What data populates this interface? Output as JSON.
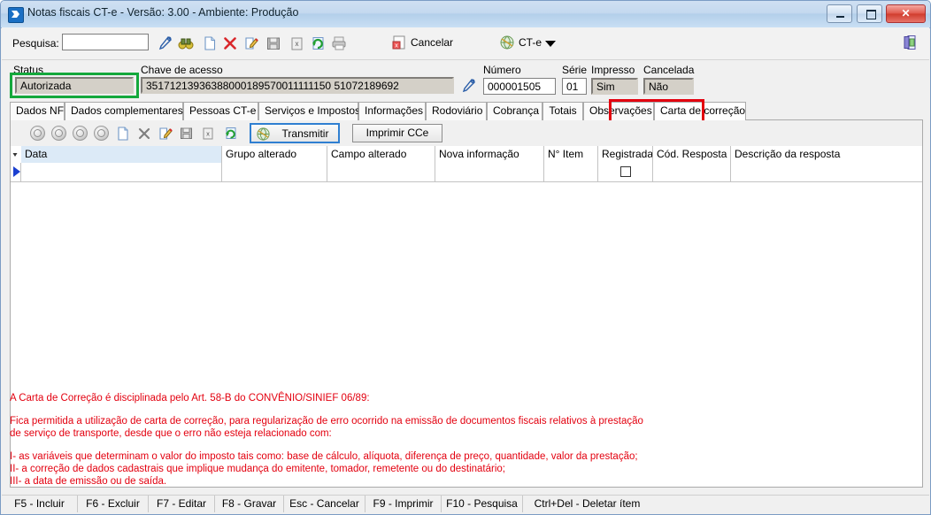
{
  "window": {
    "title": "Notas fiscais CT-e - Versão: 3.00 - Ambiente: Produção",
    "icon": "app-icon",
    "minimize_label": "",
    "maximize_label": "",
    "close_label": "✕"
  },
  "toolbar": {
    "search_label": "Pesquisa:",
    "search_value": "",
    "search_placeholder": "",
    "icons": [
      {
        "name": "filter-key-icon"
      },
      {
        "name": "binoculars-icon"
      },
      {
        "name": "new-document-icon"
      },
      {
        "name": "delete-x-icon"
      },
      {
        "name": "edit-pencil-icon"
      },
      {
        "name": "save-floppy-icon"
      },
      {
        "name": "cancel-document-icon"
      },
      {
        "name": "refresh-icon"
      },
      {
        "name": "print-icon"
      }
    ],
    "cancel_label": "Cancelar",
    "cte_label": "CT-e",
    "exit_icon": "exit-door-icon"
  },
  "header": {
    "status_label": "Status",
    "status_value": "Autorizada",
    "status_highlight_color": "#14a83c",
    "chave_label": "Chave de acesso",
    "chave_value": "35171213936388000189570011111150 51072189692",
    "chave_icon": "key-icon",
    "numero_label": "Número",
    "numero_value": "000001505",
    "serie_label": "Série",
    "serie_value": "01",
    "impresso_label": "Impresso",
    "impresso_value": "Sim",
    "cancelada_label": "Cancelada",
    "cancelada_value": "Não"
  },
  "tabs": [
    {
      "label": "Dados NF",
      "active": false
    },
    {
      "label": "Dados complementares",
      "active": false
    },
    {
      "label": "Pessoas CT-e",
      "active": false
    },
    {
      "label": "Serviços e Impostos",
      "active": false
    },
    {
      "label": "Informações",
      "active": false
    },
    {
      "label": "Rodoviário",
      "active": false
    },
    {
      "label": "Cobrança",
      "active": false
    },
    {
      "label": "Totais",
      "active": false
    },
    {
      "label": "Observações",
      "active": false
    },
    {
      "label": "Carta de correção",
      "active": true
    }
  ],
  "tab_highlight_color": "#e3000f",
  "inner_toolbar": {
    "nav_icons": [
      {
        "name": "nav-first-icon"
      },
      {
        "name": "nav-prev-icon"
      },
      {
        "name": "nav-next-icon"
      },
      {
        "name": "nav-last-icon"
      }
    ],
    "action_icons": [
      {
        "name": "new-record-icon"
      },
      {
        "name": "delete-record-icon"
      },
      {
        "name": "edit-record-icon"
      },
      {
        "name": "save-record-icon"
      },
      {
        "name": "cancel-record-icon"
      },
      {
        "name": "refresh-record-icon"
      }
    ],
    "transmitir_label": "Transmitir",
    "transmitir_icon": "cte-globe-icon",
    "imprimir_label": "Imprimir CCe"
  },
  "grid": {
    "columns": [
      {
        "label": "Data",
        "selected": true
      },
      {
        "label": "Grupo alterado",
        "selected": false
      },
      {
        "label": "Campo alterado",
        "selected": false
      },
      {
        "label": "Nova informação",
        "selected": false
      },
      {
        "label": "N° Item",
        "selected": false
      },
      {
        "label": "Registrada",
        "selected": false
      },
      {
        "label": "Cód. Resposta",
        "selected": false
      },
      {
        "label": "Descrição da resposta",
        "selected": false
      }
    ],
    "rows": [
      {
        "data": "",
        "grupo": "",
        "campo": "",
        "nova": "",
        "item": "",
        "registrada_checked": false,
        "cod": "",
        "descricao": ""
      }
    ]
  },
  "legal": {
    "line1": "A Carta de Correção é disciplinada pelo Art. 58-B do CONVÊNIO/SINIEF 06/89:",
    "line2": "Fica permitida a utilização de carta de correção, para regularização de erro ocorrido na emissão de documentos fiscais relativos à prestação",
    "line3": "de serviço de transporte, desde que o erro não esteja relacionado com:",
    "line4": "I- as variáveis que determinam o valor do imposto tais como: base de cálculo, alíquota, diferença de preço, quantidade, valor da prestação;",
    "line5": "II- a correção de dados cadastrais que implique mudança do emitente, tomador, remetente ou do destinatário;",
    "line6": "III- a data de emissão ou de saída.",
    "color": "#e3000f"
  },
  "statusbar": [
    {
      "label": "F5 - Incluir"
    },
    {
      "label": "F6 - Excluir"
    },
    {
      "label": "F7 - Editar"
    },
    {
      "label": "F8 - Gravar"
    },
    {
      "label": "Esc - Cancelar"
    },
    {
      "label": "F9 - Imprimir"
    },
    {
      "label": "F10 - Pesquisa"
    },
    {
      "label": "Ctrl+Del - Deletar ítem"
    }
  ]
}
